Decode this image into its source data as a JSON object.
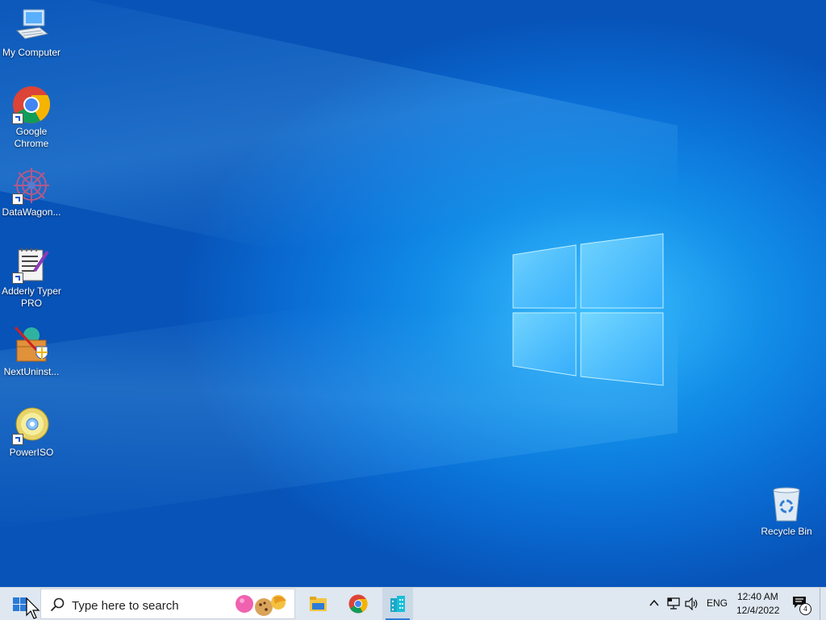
{
  "desktop": {
    "icons": [
      {
        "label": "My Computer",
        "icon": "computer-icon"
      },
      {
        "label": "Google Chrome",
        "icon": "chrome-icon"
      },
      {
        "label": "DataWagon...",
        "icon": "datawagon-icon"
      },
      {
        "label": "Adderly Typer PRO",
        "icon": "notepad-icon"
      },
      {
        "label": "NextUninst...",
        "icon": "uninstaller-icon"
      },
      {
        "label": "PowerISO",
        "icon": "disc-icon"
      },
      {
        "label": "Recycle Bin",
        "icon": "recycle-bin-icon"
      }
    ]
  },
  "taskbar": {
    "search_placeholder": "Type here to search",
    "apps": [
      "file-explorer-icon",
      "chrome-icon",
      "building-app-icon"
    ],
    "tray": {
      "language": "ENG",
      "time": "12:40 AM",
      "date": "12/4/2022",
      "notification_count": "4"
    }
  },
  "colors": {
    "accent": "#2b7bd8",
    "taskbar": "#dfe7f0"
  }
}
